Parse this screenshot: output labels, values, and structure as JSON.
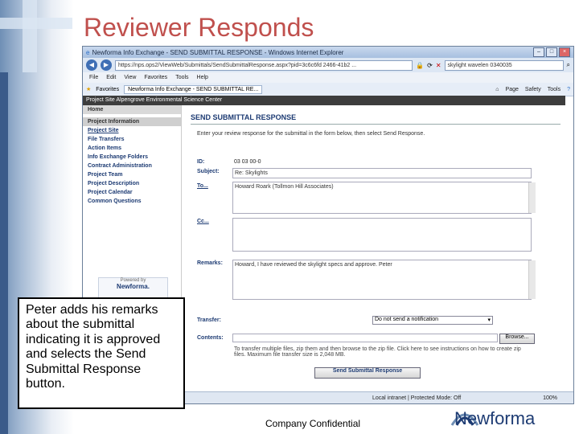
{
  "slide": {
    "title": "Reviewer Responds",
    "callout": "Peter adds his remarks about the submittal indicating it is approved and selects the Send Submittal Response button.",
    "footer": "Company Confidential",
    "logo_text": "Newforma"
  },
  "browser": {
    "title": "Newforma Info Exchange - SEND SUBMITTAL RESPONSE - Windows Internet Explorer",
    "url": "https://nps.ops2/ViewWeb/Submittals/SendSubmittalResponse.aspx?pid=3c6c6fd 2466-41b2 ...",
    "search_value": "skylight wavelen 0340035",
    "menu": [
      "File",
      "Edit",
      "View",
      "Favorites",
      "Tools",
      "Help"
    ],
    "favorites_label": "Favorites",
    "tab_label": "Newforma Info Exchange - SEND SUBMITTAL RE...",
    "commands": [
      "Page",
      "Safety",
      "Tools"
    ],
    "status_zone": "Local intranet | Protected Mode: Off",
    "zoom": "100%"
  },
  "app": {
    "project_bar": "Project Site   Alpengrove Environmental Science Center",
    "nav": {
      "home": "Home",
      "section": "Project Information",
      "items": [
        "Project Site",
        "File Transfers",
        "Action Items",
        "Info Exchange Folders",
        "Contract Administration",
        "Project Team",
        "Project Description",
        "Project Calendar",
        "Common Questions"
      ]
    },
    "powered_by": "Newforma.",
    "form": {
      "heading": "SEND SUBMITTAL RESPONSE",
      "instruction": "Enter your review response for the submittal in the form below, then select Send Response.",
      "id_label": "ID:",
      "id_value": "03 03 00-0",
      "subject_label": "Subject:",
      "subject_value": "Re: Skylights",
      "to_label": "To...",
      "to_value": "Howard Roark (Tollmon Hill Associates)",
      "cc_label": "Cc...",
      "cc_value": "",
      "remarks_label": "Remarks:",
      "remarks_value": "Howard, I have reviewed the skylight specs and approve. Peter",
      "transfer_label": "Transfer:",
      "transfer_text": "Do not send a notification",
      "contents_label": "Contents:",
      "browse_label": "Browse...",
      "upload_note": "To transfer multiple files, zip them and then browse to the zip file. Click here to see instructions on how to create zip files. Maximum file transfer size is 2,048 MB.",
      "send_button": "Send Submittal Response"
    }
  }
}
